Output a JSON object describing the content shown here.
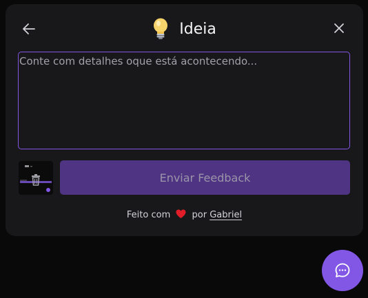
{
  "widget": {
    "title": "Ideia",
    "title_icon": "lightbulb-icon",
    "back_icon": "arrow-left-icon",
    "close_icon": "close-icon",
    "textarea": {
      "placeholder": "Conte com detalhes oque está acontecendo...",
      "value": ""
    },
    "screenshot": {
      "icon": "trash-icon"
    },
    "submit_label": "Enviar Feedback",
    "footer": {
      "prefix": "Feito com",
      "heart_icon": "heart-icon",
      "middle": "por",
      "author_link": "Gabriel"
    }
  },
  "fab": {
    "icon": "chat-bubble-icon"
  },
  "colors": {
    "accent": "#8257e5",
    "accent_disabled": "#4f3484",
    "surface": "#18181b",
    "background": "#09090a",
    "heart": "#e11d2a"
  }
}
